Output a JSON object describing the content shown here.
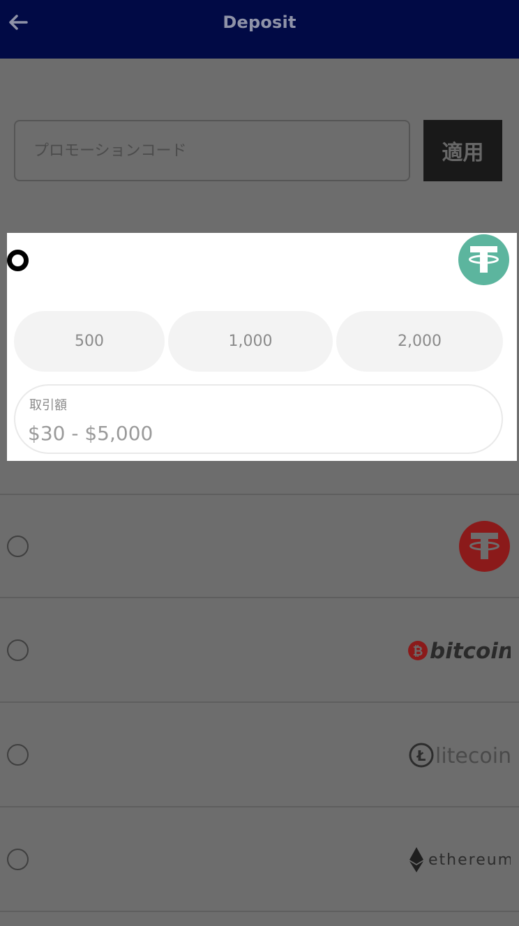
{
  "header": {
    "title": "Deposit",
    "back_icon": "arrow-left-icon"
  },
  "promo": {
    "placeholder": "プロモーションコード",
    "apply_label": "適用"
  },
  "selected_method": {
    "logo": "tether-icon",
    "color": "#5cb59e",
    "presets": [
      "500",
      "1,000",
      "2,000"
    ],
    "amount_label": "取引額",
    "amount_placeholder": "$30 - $5,000"
  },
  "methods": [
    {
      "logo": "tether-icon",
      "color": "#8b1a1a"
    },
    {
      "logo": "bitcoin-logo",
      "text": "bitcoin",
      "color": "#8b1a1a"
    },
    {
      "logo": "litecoin-logo",
      "text": "litecoin",
      "color": "#2c2c2c"
    },
    {
      "logo": "ethereum-logo",
      "text": "ethereum",
      "color": "#2c2c2c"
    }
  ],
  "colors": {
    "header_bg": "#010a45",
    "overlay_bg": "#6d6d6d",
    "card_bg": "#ffffff",
    "chip_bg": "#f3f3f3"
  }
}
